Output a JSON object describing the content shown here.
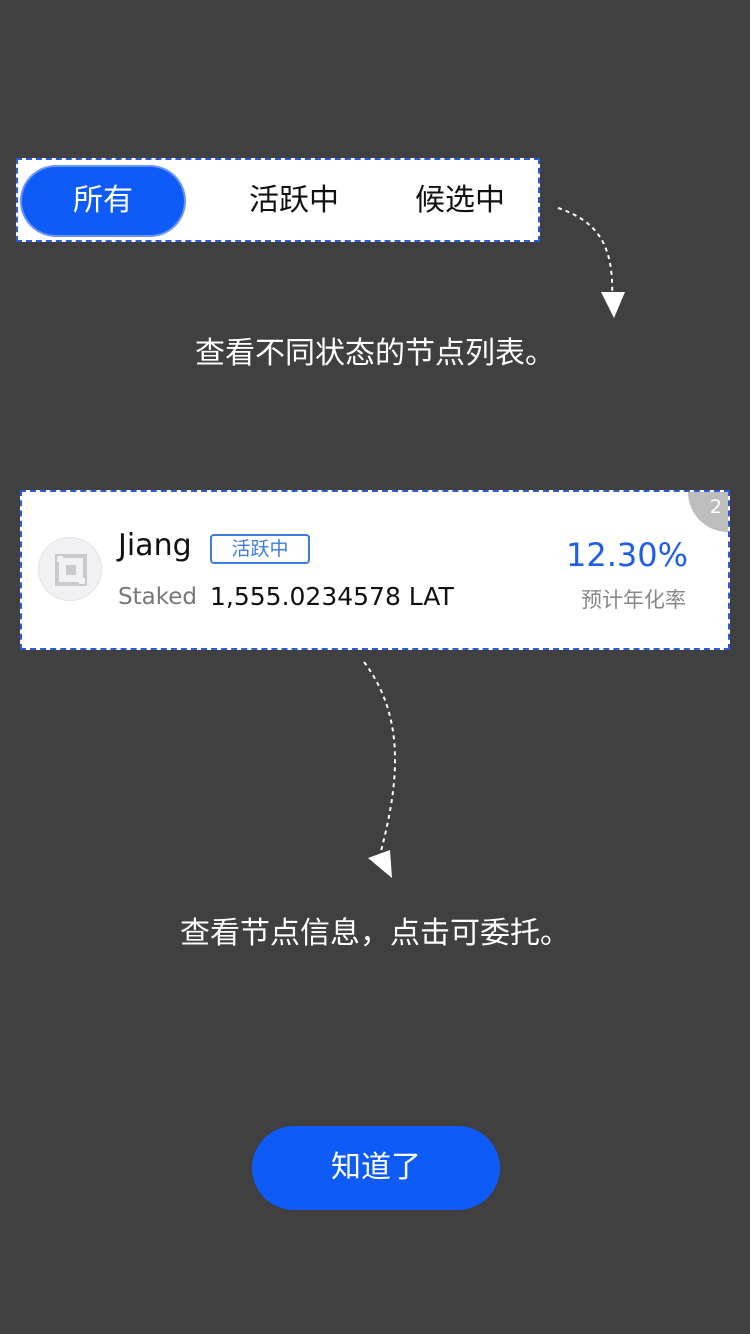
{
  "tabs": [
    {
      "label": "所有",
      "active": true
    },
    {
      "label": "活跃中",
      "active": false
    },
    {
      "label": "候选中",
      "active": false
    }
  ],
  "hints": {
    "tabs_hint": "查看不同状态的节点列表。",
    "card_hint": "查看节点信息，点击可委托。"
  },
  "node": {
    "name": "Jiang",
    "status": "活跃中",
    "staked_label": "Staked",
    "staked_value": "1,555.0234578 LAT",
    "rate": "12.30%",
    "rate_label": "预计年化率",
    "rank": "2",
    "avatar_icon": "node-avatar-icon"
  },
  "button": {
    "label": "知道了"
  },
  "colors": {
    "overlay": "#404040",
    "accent": "#0f5bf7",
    "rate": "#1f5ee8"
  }
}
